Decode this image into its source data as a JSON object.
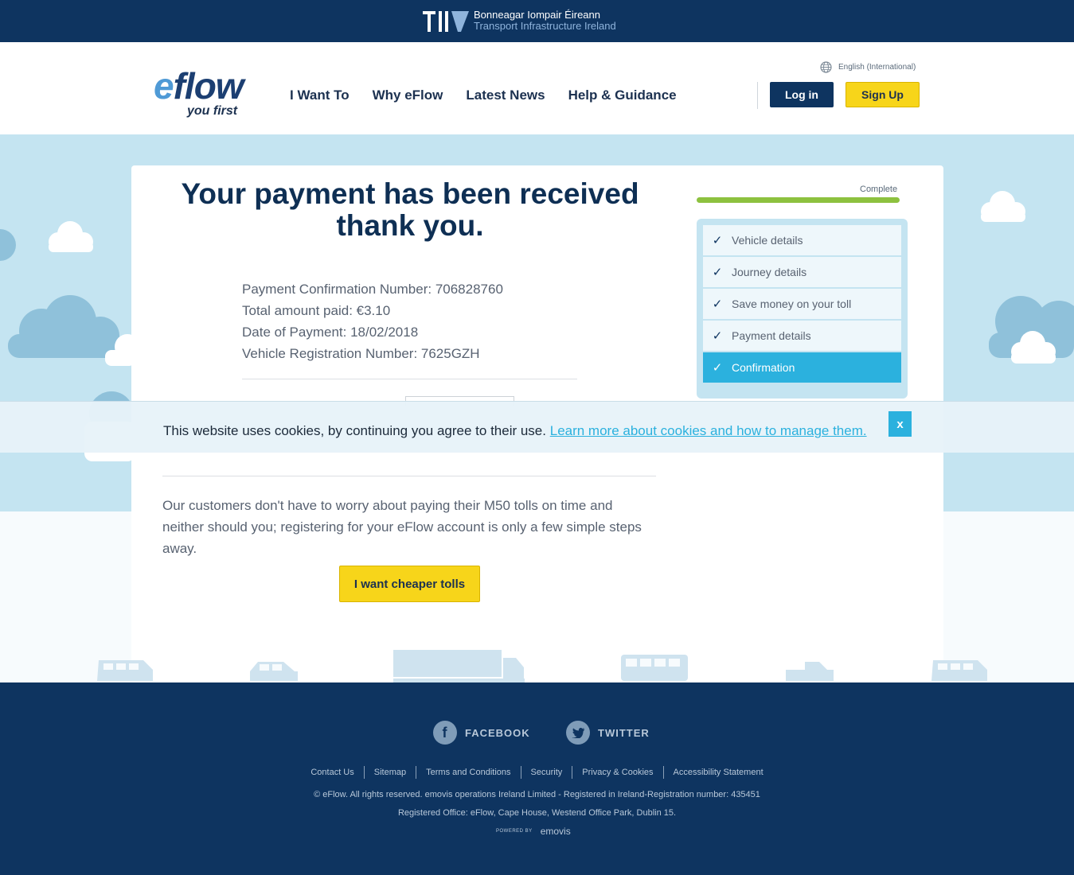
{
  "tii": {
    "line1": "Bonneagar Iompair Éireann",
    "line2": "Transport Infrastructure Ireland"
  },
  "header": {
    "logo_main": "eFlow",
    "logo_sub": "you first",
    "nav": [
      "I Want To",
      "Why eFlow",
      "Latest News",
      "Help & Guidance"
    ],
    "language": "English (International)",
    "login_label": "Log in",
    "signup_label": "Sign Up"
  },
  "main": {
    "heading_line1": "Your payment has been received",
    "heading_line2": "thank you.",
    "details": [
      "Payment Confirmation Number: 706828760",
      "Total amount paid: €3.10",
      "Date of Payment: 18/02/2018",
      "Vehicle Registration Number: 7625GZH"
    ],
    "promo_text": "Our customers don't have to worry about paying their M50 tolls on time and neither should you; registering for your eFlow account is only a few simple steps away.",
    "cta_label": "I want cheaper tolls"
  },
  "progress": {
    "label": "Complete",
    "percent": 100,
    "steps": [
      {
        "label": "Vehicle details",
        "done": true,
        "active": false
      },
      {
        "label": "Journey details",
        "done": true,
        "active": false
      },
      {
        "label": "Save money on your toll",
        "done": true,
        "active": false
      },
      {
        "label": "Payment details",
        "done": true,
        "active": false
      },
      {
        "label": "Confirmation",
        "done": true,
        "active": true
      }
    ],
    "check_glyph": "✓"
  },
  "cookie": {
    "text": "This website uses cookies, by continuing you agree to their use.",
    "link": "Learn more about cookies and how to manage them.",
    "close_label": "x"
  },
  "footer": {
    "facebook_label": "FACEBOOK",
    "twitter_label": "TWITTER",
    "links": [
      "Contact Us",
      "Sitemap",
      "Terms and Conditions",
      "Security",
      "Privacy & Cookies",
      "Accessibility Statement"
    ],
    "copyright": "© eFlow. All rights reserved. emovis operations Ireland Limited - Registered in Ireland-Registration number: 435451",
    "office": "Registered Office: eFlow, Cape House, Westend Office Park, Dublin 15.",
    "powered_by": "POWERED BY",
    "powered_brand": "emovis"
  },
  "colors": {
    "navy": "#0e3460",
    "sky": "#c4e4f1",
    "accent_blue": "#2bb1de",
    "yellow": "#f7d51a",
    "green": "#8dc13f"
  }
}
